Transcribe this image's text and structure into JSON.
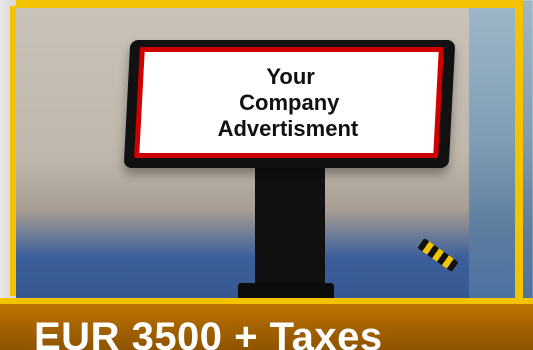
{
  "advert": {
    "line1": "Your",
    "line2": "Company",
    "line3": "Advertisment"
  },
  "price_banner": {
    "text": "EUR 3500 + Taxes"
  },
  "colors": {
    "accent_gold": "#f3c200",
    "banner_brown": "#a56200",
    "card_border_red": "#d00000"
  }
}
